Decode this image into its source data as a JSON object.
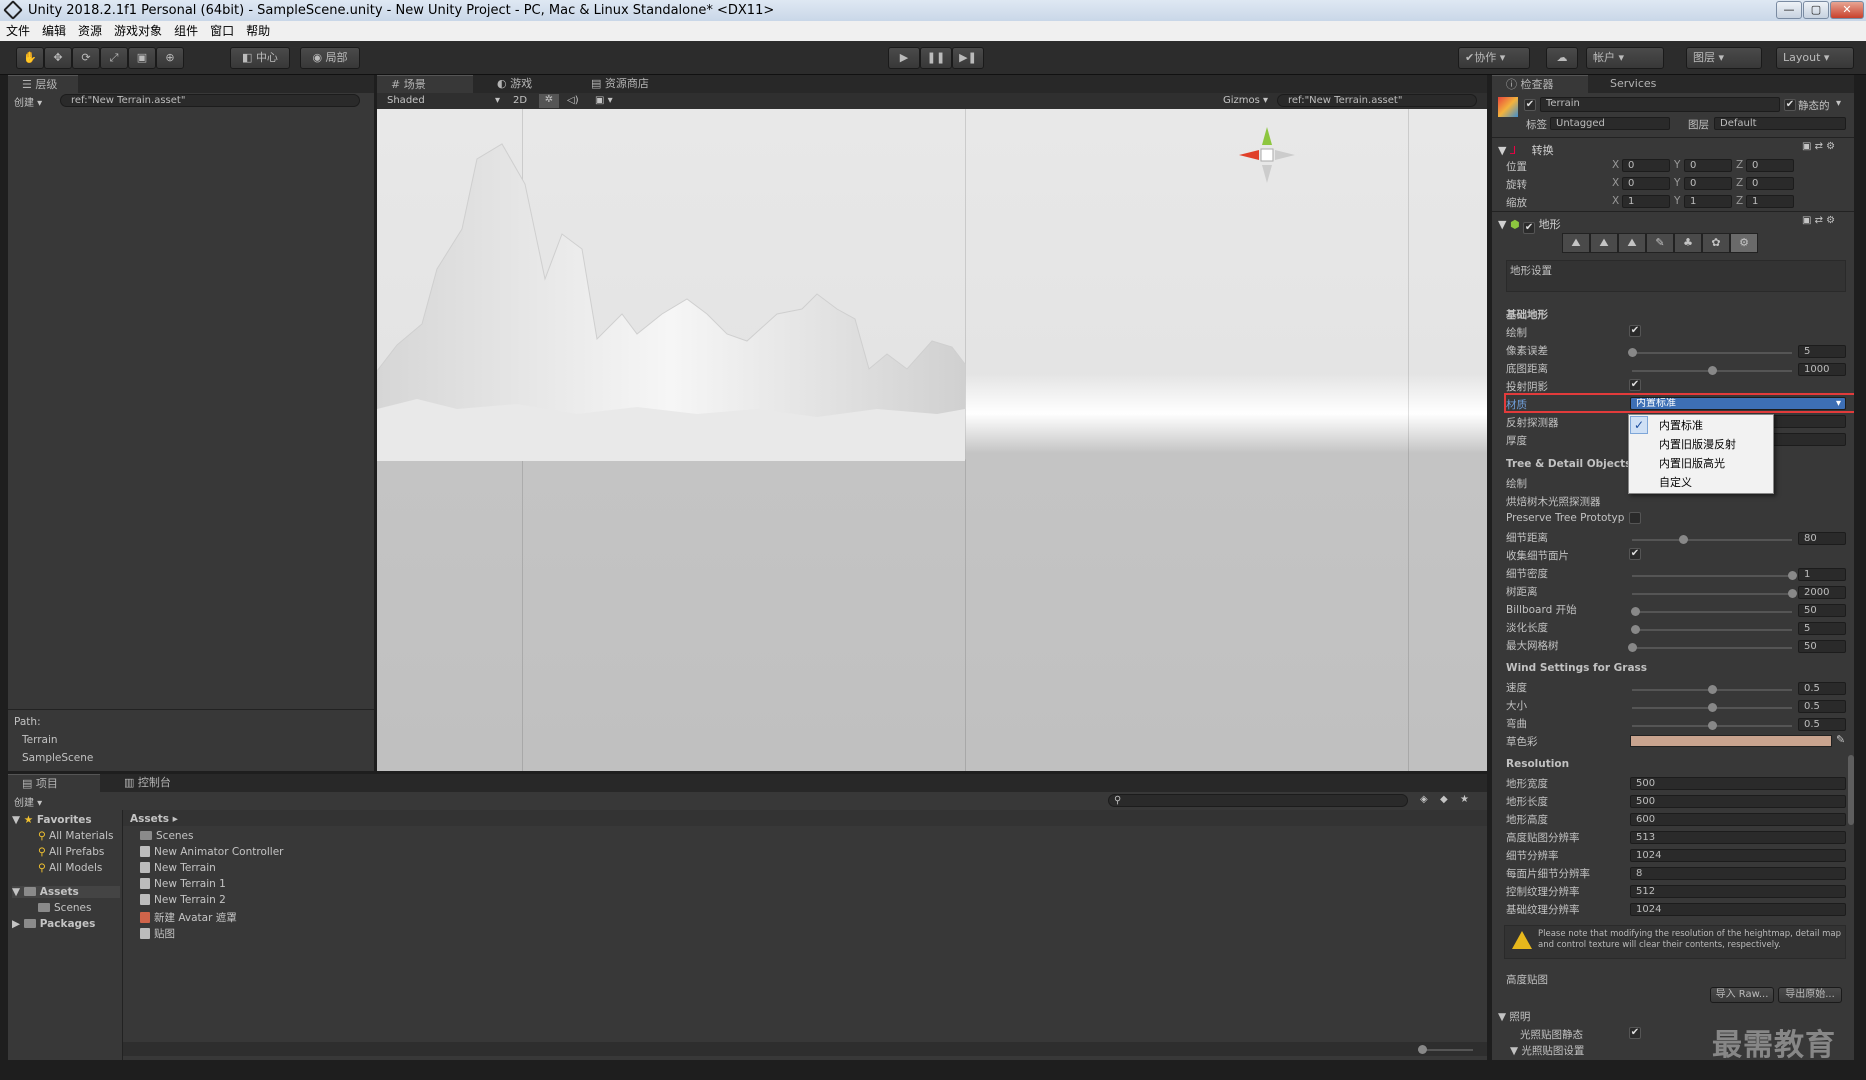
{
  "window": {
    "title": "Unity 2018.2.1f1 Personal (64bit) - SampleScene.unity - New Unity Project - PC, Mac & Linux Standalone* <DX11>"
  },
  "menu": [
    "文件",
    "编辑",
    "资源",
    "游戏对象",
    "组件",
    "窗口",
    "帮助"
  ],
  "toolbar": {
    "pivot": "中心",
    "space": "局部",
    "collab": "协作",
    "account": "帐户",
    "layers": "图层",
    "layout": "Layout"
  },
  "hierarchy": {
    "tab": "层级",
    "create": "创建",
    "search": "ref:\"New Terrain.asset\"",
    "path_label": "Path:",
    "path": [
      "Terrain",
      "SampleScene"
    ]
  },
  "scene": {
    "tabs": [
      "场景",
      "游戏",
      "资源商店"
    ],
    "shading": "Shaded",
    "mode2d": "2D",
    "gizmos": "Gizmos",
    "search": "ref:\"New Terrain.asset\""
  },
  "project": {
    "tabs": [
      "项目",
      "控制台"
    ],
    "create": "创建",
    "favorites_label": "Favorites",
    "favorites": [
      "All Materials",
      "All Prefabs",
      "All Models"
    ],
    "assets_label": "Assets",
    "assets_children": [
      "Scenes"
    ],
    "packages_label": "Packages",
    "breadcrumb": "Assets",
    "files": [
      "Scenes",
      "New Animator Controller",
      "New Terrain",
      "New Terrain 1",
      "New Terrain 2",
      "新建 Avatar 遮罩",
      "贴图"
    ]
  },
  "inspector": {
    "tabs": [
      "检查器",
      "Services"
    ],
    "object_name": "Terrain",
    "static_label": "静态的",
    "tag_label": "标签",
    "tag": "Untagged",
    "layer_label": "图层",
    "layer": "Default",
    "transform": {
      "title": "转换",
      "rows": [
        {
          "label": "位置",
          "x": "0",
          "y": "0",
          "z": "0"
        },
        {
          "label": "旋转",
          "x": "0",
          "y": "0",
          "z": "0"
        },
        {
          "label": "缩放",
          "x": "1",
          "y": "1",
          "z": "1"
        }
      ]
    },
    "terrain": {
      "title": "地形",
      "settings_label": "地形设置",
      "basic_title": "基础地形",
      "draw": "绘制",
      "pixel_error": {
        "label": "像素误差",
        "value": "5",
        "pos": 0.0
      },
      "basemap_dist": {
        "label": "底图距离",
        "value": "1000",
        "pos": 0.5
      },
      "cast_shadows": "投射阴影",
      "material": {
        "label": "材质",
        "value": "内置标准"
      },
      "reflection": "反射探测器",
      "thickness": "厚度",
      "tree_title": "Tree & Detail Objects",
      "tree_draw": "绘制",
      "bake_probe": "烘焙树木光照探测器",
      "preserve": "Preserve Tree Prototyp",
      "detail_dist": {
        "label": "细节距离",
        "value": "80",
        "pos": 0.32
      },
      "collect_detail": "收集细节面片",
      "detail_density": {
        "label": "细节密度",
        "value": "1",
        "pos": 1.0
      },
      "tree_dist": {
        "label": "树距离",
        "value": "2000",
        "pos": 1.0
      },
      "billboard": {
        "label": "Billboard 开始",
        "value": "50",
        "pos": 0.02
      },
      "fade": {
        "label": "淡化长度",
        "value": "5",
        "pos": 0.02
      },
      "max_mesh": {
        "label": "最大网格树",
        "value": "50",
        "pos": 0.0
      },
      "wind_title": "Wind Settings for Grass",
      "speed": {
        "label": "速度",
        "value": "0.5",
        "pos": 0.5
      },
      "size": {
        "label": "大小",
        "value": "0.5",
        "pos": 0.5
      },
      "bending": {
        "label": "弯曲",
        "value": "0.5",
        "pos": 0.5
      },
      "grass_tint": "草色彩",
      "res_title": "Resolution",
      "res": [
        {
          "label": "地形宽度",
          "value": "500"
        },
        {
          "label": "地形长度",
          "value": "500"
        },
        {
          "label": "地形高度",
          "value": "600"
        },
        {
          "label": "高度贴图分辨率",
          "value": "513"
        },
        {
          "label": "细节分辨率",
          "value": "1024"
        },
        {
          "label": "每面片细节分辨率",
          "value": "8"
        },
        {
          "label": "控制纹理分辨率",
          "value": "512"
        },
        {
          "label": "基础纹理分辨率",
          "value": "1024"
        }
      ],
      "warning": "Please note that modifying the resolution of the heightmap, detail map and control texture will clear their contents, respectively.",
      "heightmap": "高度贴图",
      "import": "导入 Raw...",
      "export": "导出原始...",
      "lighting": "照明",
      "lightmap_static": "光照贴图静态",
      "lightmap_settings": "光照贴图设置"
    },
    "dropdown": [
      "内置标准",
      "内置旧版漫反射",
      "内置旧版高光",
      "自定义"
    ]
  },
  "colors": {
    "highlight": "#e23b3b",
    "grass_tint": "#c9a48f",
    "selected": "#3d6fb5"
  },
  "watermark": "最需教育"
}
